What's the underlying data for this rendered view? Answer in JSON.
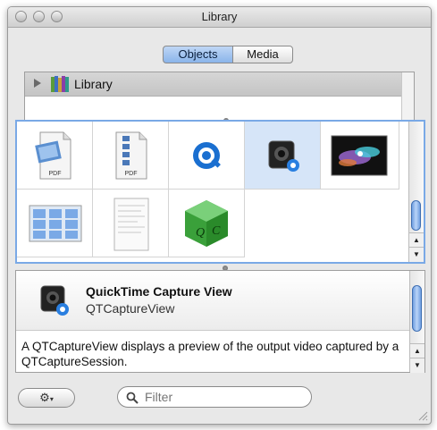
{
  "window": {
    "title": "Library"
  },
  "segments": {
    "objects": "Objects",
    "media": "Media"
  },
  "outline": {
    "item": "Library",
    "expanded": false
  },
  "grid": {
    "items": [
      {
        "icon": "pdf-photo-icon",
        "label": "PDF",
        "selected": false
      },
      {
        "icon": "pdf-list-icon",
        "label": "PDF",
        "selected": false
      },
      {
        "icon": "quicktime-icon",
        "label": "",
        "selected": false
      },
      {
        "icon": "qt-capture-view-icon",
        "label": "",
        "selected": true
      },
      {
        "icon": "quartz-composer-view-icon",
        "label": "",
        "selected": false
      },
      {
        "icon": "image-browser-icon",
        "label": "",
        "selected": false
      },
      {
        "icon": "document-view-icon",
        "label": "",
        "selected": false
      },
      {
        "icon": "qc-cube-icon",
        "label": "",
        "selected": false
      }
    ]
  },
  "detail": {
    "name": "QuickTime Capture View",
    "class_name": "QTCaptureView",
    "description": "A QTCaptureView displays a preview of the output video captured by a QTCaptureSession."
  },
  "bottom": {
    "filter_placeholder": "Filter"
  },
  "colors": {
    "selection": "#d6e5f8",
    "accent": "#7aa9e6",
    "segment_active": "#8ab4ea"
  }
}
